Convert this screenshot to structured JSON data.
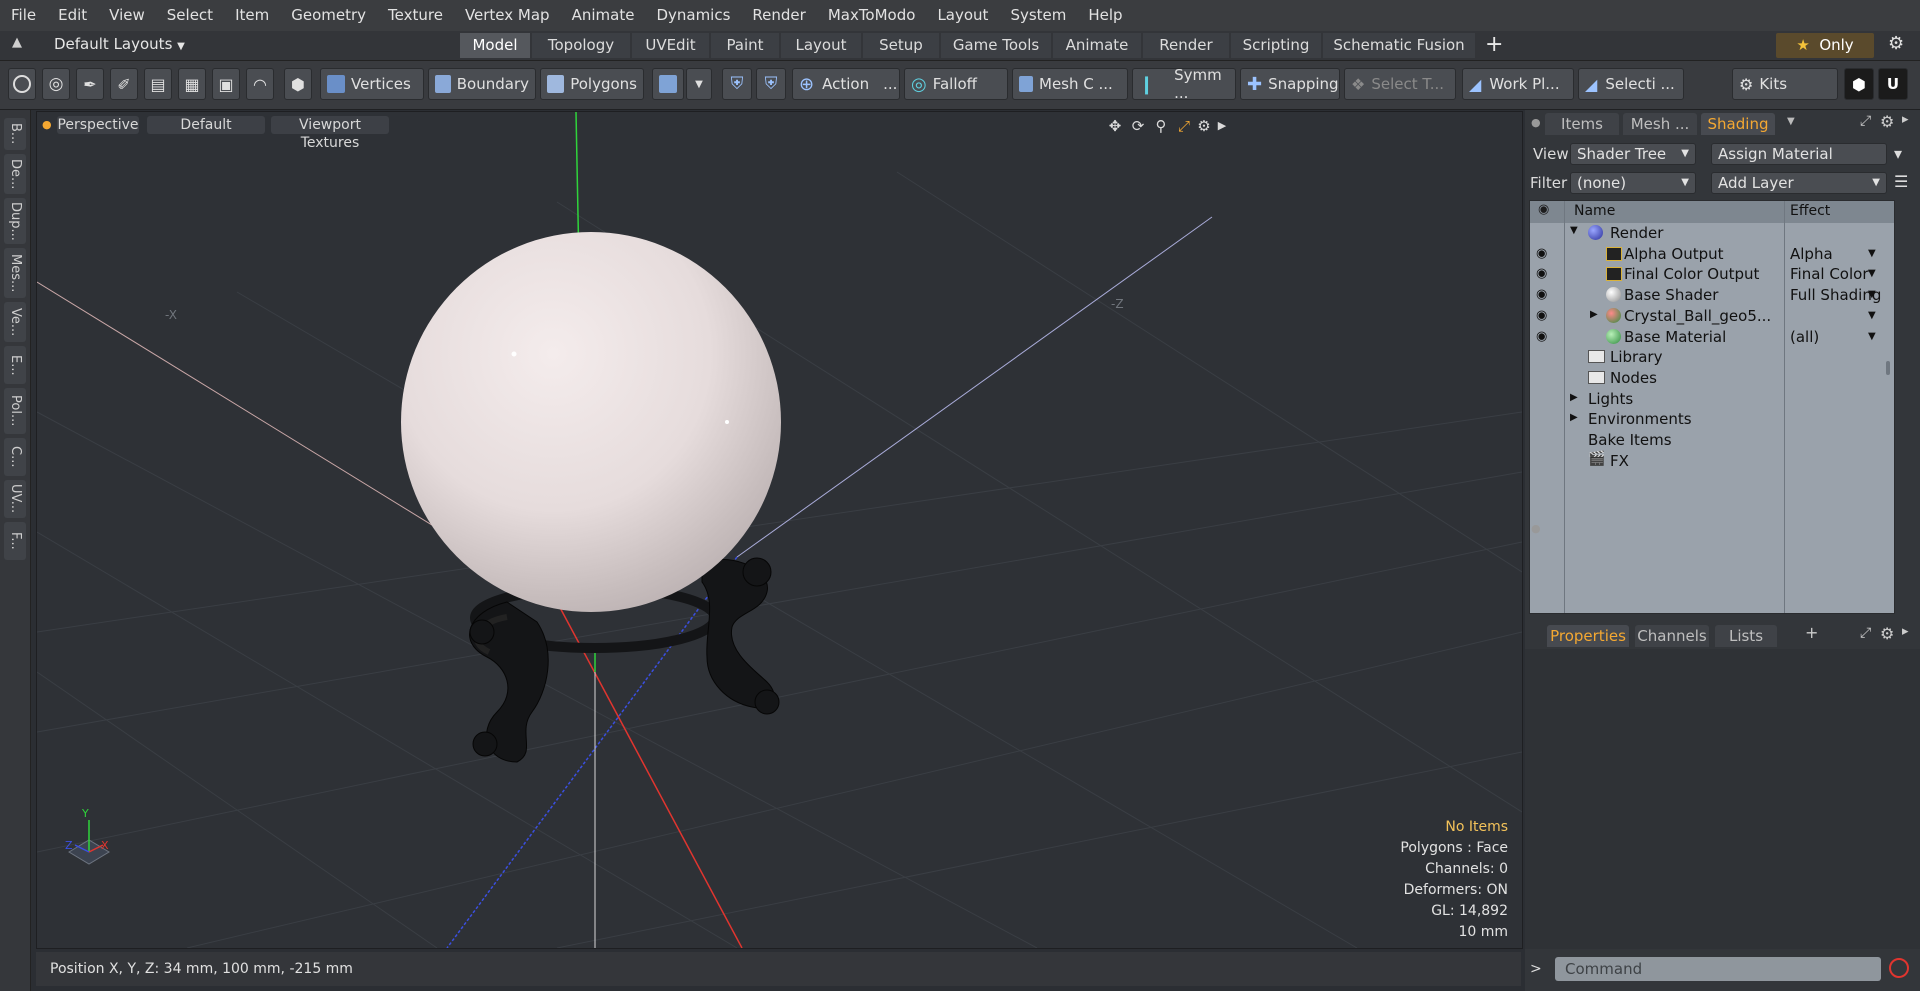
{
  "menu": [
    "File",
    "Edit",
    "View",
    "Select",
    "Item",
    "Geometry",
    "Texture",
    "Vertex Map",
    "Animate",
    "Dynamics",
    "Render",
    "MaxToModo",
    "Layout",
    "System",
    "Help"
  ],
  "layouts": {
    "preset": "Default Layouts",
    "tabs": [
      "Model",
      "Topology",
      "UVEdit",
      "Paint",
      "Layout",
      "Setup",
      "Game Tools",
      "Animate",
      "Render",
      "Scripting",
      "Schematic Fusion"
    ],
    "active": "Model",
    "only_label": "Only"
  },
  "toolbar": {
    "vertices": "Vertices",
    "boundary": "Boundary",
    "polygons": "Polygons",
    "action": "Action",
    "falloff": "Falloff",
    "mesh": "Mesh C ...",
    "symm": "Symm ...",
    "snapping": "Snapping",
    "select_t": "Select T...",
    "workplane": "Work Pl...",
    "selecti": "Selecti ...",
    "kits": "Kits"
  },
  "left_tabs": [
    "B...",
    "De...",
    "Dup...",
    "Mes...",
    "Ve...",
    "E...",
    "Pol...",
    "C...",
    "UV...",
    "F..."
  ],
  "viewport": {
    "view": "Perspective",
    "shading": "Default",
    "textures": "Viewport Textures",
    "axis_x_neg": "-X",
    "axis_z_neg": "-Z",
    "gizmo_y": "Y",
    "gizmo_x": "X",
    "gizmo_z": "Z",
    "hud": {
      "selection": "No Items",
      "polygons": "Polygons : Face",
      "channels": "Channels: 0",
      "deformers": "Deformers: ON",
      "gl": "GL: 14,892",
      "unit": "10 mm"
    }
  },
  "status": {
    "position": "Position X, Y, Z:  34 mm, 100 mm, -215 mm"
  },
  "right_panel": {
    "top_tabs": [
      "Items",
      "Mesh ...",
      "Shading"
    ],
    "active_tab": "Shading",
    "view_label": "View",
    "view_value": "Shader Tree",
    "assign_material": "Assign Material",
    "filter_label": "Filter",
    "filter_value": "(none)",
    "add_layer": "Add Layer",
    "col_name": "Name",
    "col_effect": "Effect",
    "rows": [
      {
        "name": "Render",
        "effect": ""
      },
      {
        "name": "Alpha Output",
        "effect": "Alpha"
      },
      {
        "name": "Final Color Output",
        "effect": "Final Color"
      },
      {
        "name": "Base Shader",
        "effect": "Full Shading"
      },
      {
        "name": "Crystal_Ball_geo5...",
        "effect": ""
      },
      {
        "name": "Base Material",
        "effect": "(all)"
      },
      {
        "name": "Library",
        "effect": ""
      },
      {
        "name": "Nodes",
        "effect": ""
      },
      {
        "name": "Lights",
        "effect": ""
      },
      {
        "name": "Environments",
        "effect": ""
      },
      {
        "name": "Bake Items",
        "effect": ""
      },
      {
        "name": "FX",
        "effect": ""
      }
    ],
    "bottom_tabs": [
      "Properties",
      "Channels",
      "Lists"
    ],
    "bottom_active": "Properties",
    "command_placeholder": "Command"
  },
  "colors": {
    "accent_orange": "#f4a832",
    "hud_warn": "#f3c25a",
    "axis_green": "#2fd43b",
    "axis_red": "#e0352f",
    "axis_blue": "#3b4fe0"
  }
}
